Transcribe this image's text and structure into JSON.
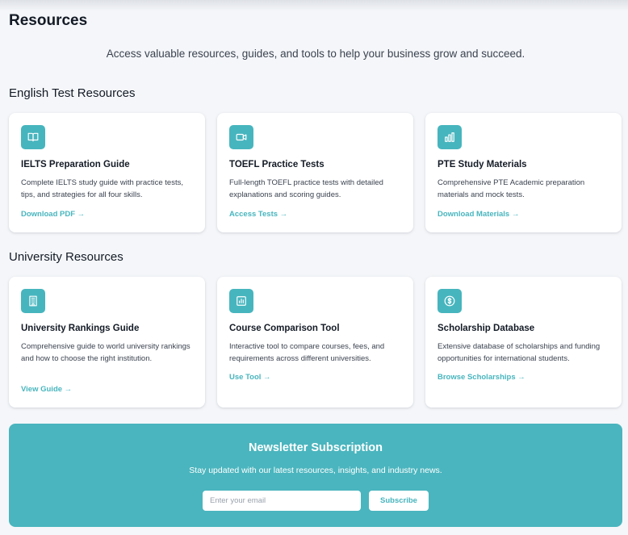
{
  "page": {
    "title": "Resources",
    "intro": "Access valuable resources, guides, and tools to help your business grow and succeed."
  },
  "english": {
    "heading": "English Test Resources",
    "cards": [
      {
        "icon": "book-icon",
        "title": "IELTS Preparation Guide",
        "desc": "Complete IELTS study guide with practice tests, tips, and strategies for all four skills.",
        "link": "Download PDF →"
      },
      {
        "icon": "video-icon",
        "title": "TOEFL Practice Tests",
        "desc": "Full-length TOEFL practice tests with detailed explanations and scoring guides.",
        "link": "Access Tests →"
      },
      {
        "icon": "bar-chart-icon",
        "title": "PTE Study Materials",
        "desc": "Comprehensive PTE Academic preparation materials and mock tests.",
        "link": "Download Materials →"
      }
    ]
  },
  "university": {
    "heading": "University Resources",
    "cards": [
      {
        "icon": "building-icon",
        "title": "University Rankings Guide",
        "desc": "Comprehensive guide to world university rankings and how to choose the right institution.",
        "link": "View Guide →"
      },
      {
        "icon": "chart-icon",
        "title": "Course Comparison Tool",
        "desc": "Interactive tool to compare courses, fees, and requirements across different universities.",
        "link": "Use Tool →"
      },
      {
        "icon": "dollar-icon",
        "title": "Scholarship Database",
        "desc": "Extensive database of scholarships and funding opportunities for international students.",
        "link": "Browse Scholarships →"
      }
    ]
  },
  "newsletter": {
    "title": "Newsletter Subscription",
    "subtitle": "Stay updated with our latest resources, insights, and industry news.",
    "email_placeholder": "Enter your email",
    "button_label": "Subscribe"
  },
  "colors": {
    "accent": "#47b5be",
    "background": "#f4f6f9",
    "card": "#ffffff",
    "text": "#141b26"
  }
}
